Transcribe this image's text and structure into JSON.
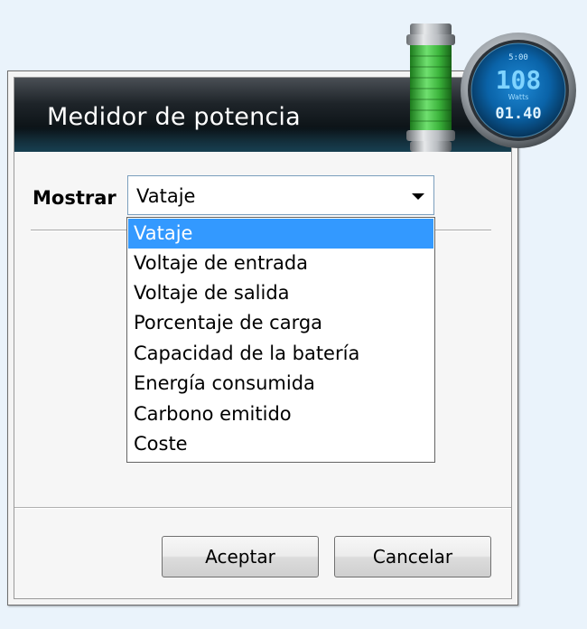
{
  "dialog": {
    "title": "Medidor de potencia"
  },
  "form": {
    "show_label": "Mostrar",
    "select_value": "Vataje"
  },
  "dropdown": {
    "options": [
      {
        "label": "Vataje",
        "selected": true
      },
      {
        "label": "Voltaje de entrada",
        "selected": false
      },
      {
        "label": "Voltaje de salida",
        "selected": false
      },
      {
        "label": "Porcentaje de carga",
        "selected": false
      },
      {
        "label": "Capacidad de la batería",
        "selected": false
      },
      {
        "label": "Energía consumida",
        "selected": false
      },
      {
        "label": "Carbono emitido",
        "selected": false
      },
      {
        "label": "Coste",
        "selected": false
      }
    ]
  },
  "buttons": {
    "accept": "Aceptar",
    "cancel": "Cancelar"
  },
  "gadget": {
    "icon": "power-meter-gadget-icon",
    "top_readout": "5:00",
    "value": "108",
    "unit": "Watts",
    "time": "01.40",
    "colors": {
      "battery_green": "#3cb43c",
      "dial_blue": "#0a63a8",
      "readout": "#7fd4ff"
    }
  },
  "colors": {
    "selection": "#3399ff",
    "header_dark": "#0b1216"
  }
}
